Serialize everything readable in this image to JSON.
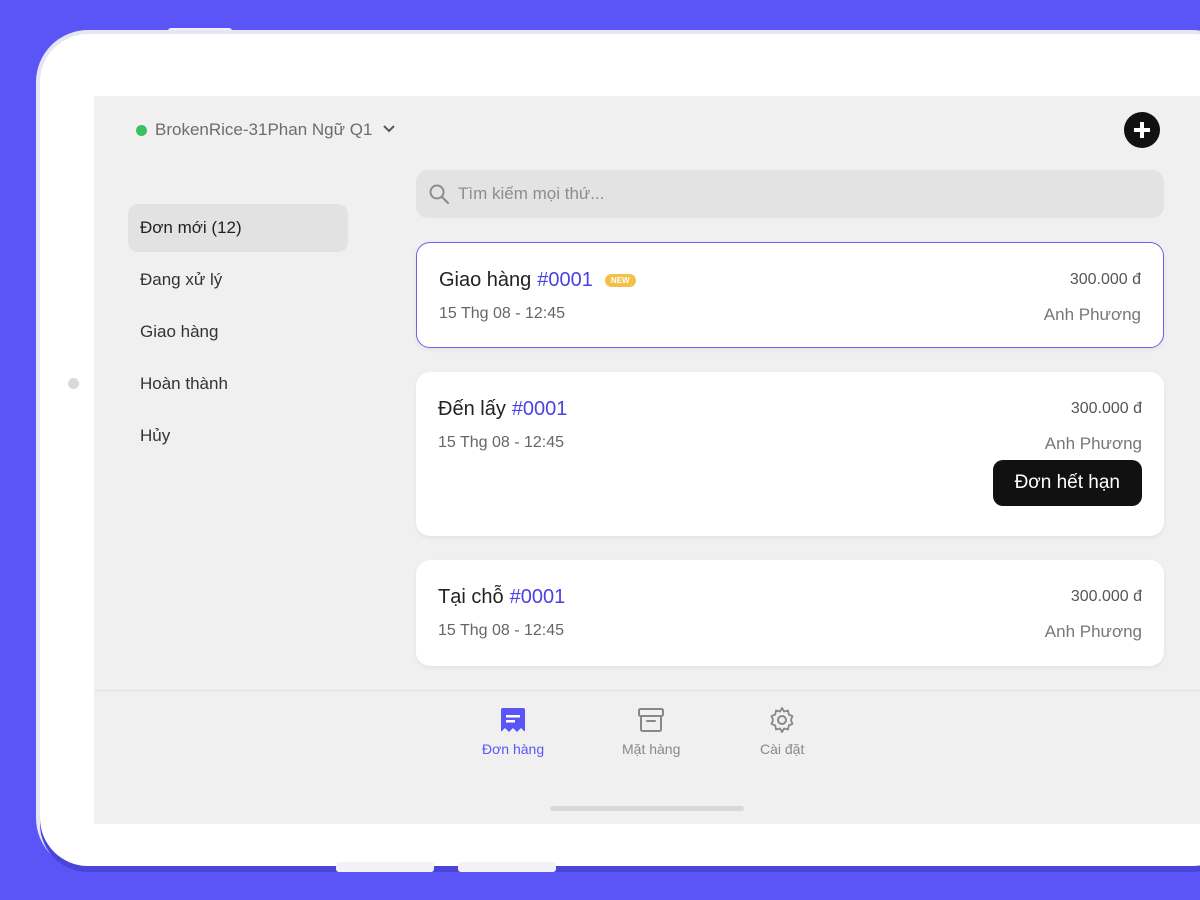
{
  "header": {
    "store_name": "BrokenRice-31Phan Ngữ Q1",
    "store_status_color": "#3fbf5c",
    "add_icon": "plus-circle-icon"
  },
  "sidebar": {
    "items": [
      {
        "label": "Đơn mới (12)",
        "active": true
      },
      {
        "label": "Đang xử lý",
        "active": false
      },
      {
        "label": "Giao hàng",
        "active": false
      },
      {
        "label": "Hoàn thành",
        "active": false
      },
      {
        "label": "Hủy",
        "active": false
      }
    ]
  },
  "search": {
    "placeholder": "Tìm kiếm mọi thứ..."
  },
  "orders": [
    {
      "type": "Giao hàng",
      "id": "#0001",
      "badge": "NEW",
      "time": "15 Thg 08 - 12:45",
      "price": "300.000 đ",
      "customer": "Anh Phương",
      "selected": true
    },
    {
      "type": "Đến lấy",
      "id": "#0001",
      "time": "15 Thg 08 - 12:45",
      "price": "300.000 đ",
      "customer": "Anh Phương",
      "action": "Đơn hết hạn"
    },
    {
      "type": "Tại chỗ",
      "id": "#0001",
      "time": "15 Thg 08 - 12:45",
      "price": "300.000 đ",
      "customer": "Anh Phương"
    }
  ],
  "bottom_nav": {
    "items": [
      {
        "label": "Đơn hàng",
        "icon": "orders-icon",
        "active": true
      },
      {
        "label": "Mặt hàng",
        "icon": "archive-box-icon",
        "active": false
      },
      {
        "label": "Cài đặt",
        "icon": "gear-icon",
        "active": false
      }
    ]
  },
  "colors": {
    "accent": "#5b55f7",
    "order_id": "#4b43e0",
    "badge": "#f5c04a"
  }
}
